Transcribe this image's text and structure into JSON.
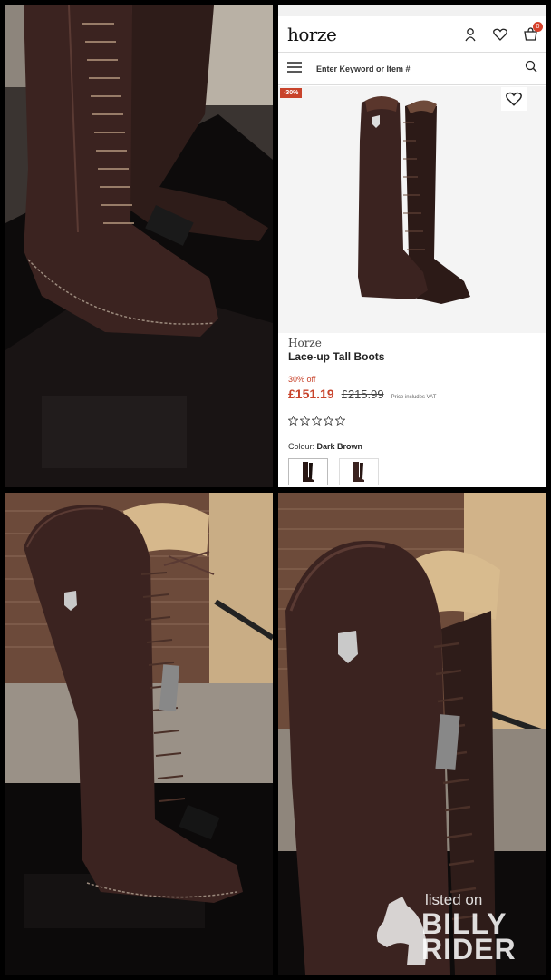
{
  "shop": {
    "logo": "horze",
    "cart_count": "0",
    "search_placeholder": "Enter Keyword or Item #",
    "discount_tag": "-30%",
    "brand": "Horze",
    "product_name": "Lace-up Tall Boots",
    "off_text": "30% off",
    "price": "£151.19",
    "old_price": "£215.99",
    "vat_note": "Price includes VAT",
    "colour_label": "Colour:",
    "colour_value": "Dark Brown",
    "rating_stars": 0,
    "icons": [
      "user-icon",
      "heart-icon",
      "cart-icon",
      "menu-icon",
      "search-icon"
    ]
  },
  "watermark": {
    "line_small": "listed on",
    "line_big_1": "BILLY",
    "line_big_2": "RIDER"
  },
  "colors": {
    "accent": "#c8432b",
    "boot_leather": "#3b2320"
  }
}
